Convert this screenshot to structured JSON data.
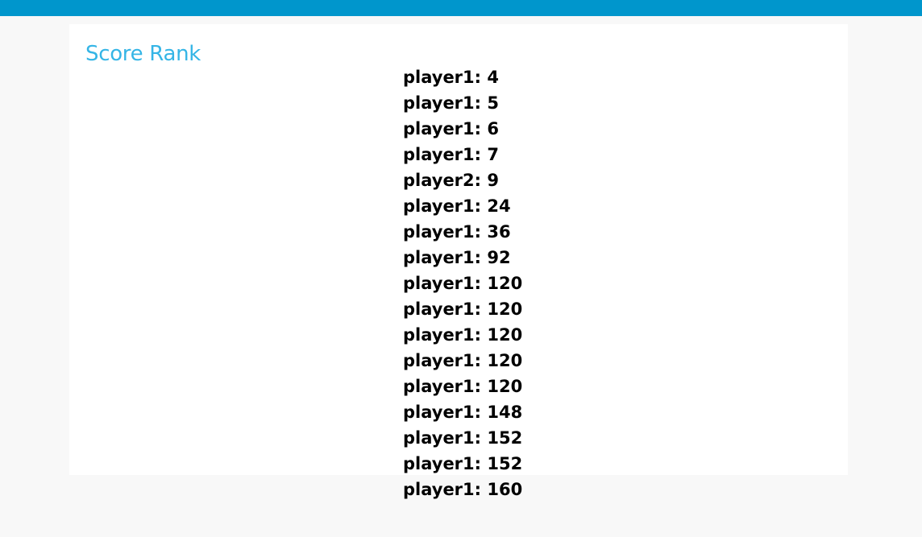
{
  "colors": {
    "header_bar": "#0096cc",
    "title": "#35b5e6",
    "page_background": "#f8f8f8",
    "card_background": "#ffffff",
    "text": "#000000"
  },
  "page": {
    "title": "Score Rank"
  },
  "scores": [
    {
      "player": "player1",
      "score": "4"
    },
    {
      "player": "player1",
      "score": "5"
    },
    {
      "player": "player1",
      "score": "6"
    },
    {
      "player": "player1",
      "score": "7"
    },
    {
      "player": "player2",
      "score": "9"
    },
    {
      "player": "player1",
      "score": "24"
    },
    {
      "player": "player1",
      "score": "36"
    },
    {
      "player": "player1",
      "score": "92"
    },
    {
      "player": "player1",
      "score": "120"
    },
    {
      "player": "player1",
      "score": "120"
    },
    {
      "player": "player1",
      "score": "120"
    },
    {
      "player": "player1",
      "score": "120"
    },
    {
      "player": "player1",
      "score": "120"
    },
    {
      "player": "player1",
      "score": "148"
    },
    {
      "player": "player1",
      "score": "152"
    },
    {
      "player": "player1",
      "score": "152"
    },
    {
      "player": "player1",
      "score": "160"
    }
  ]
}
